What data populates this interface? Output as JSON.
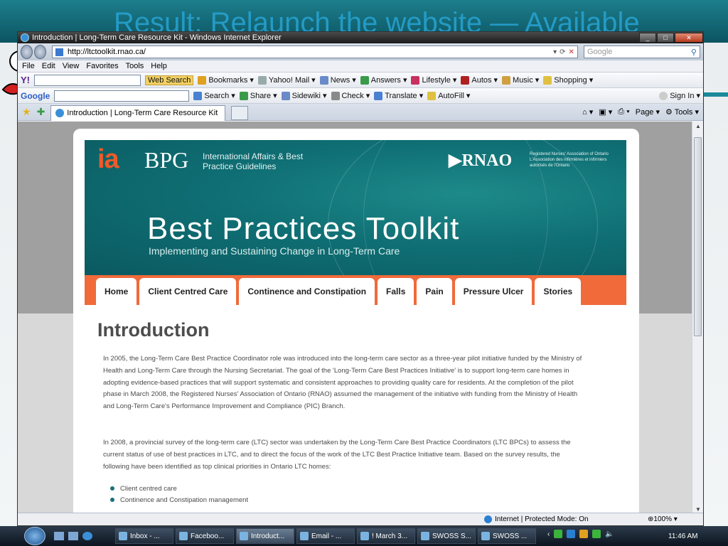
{
  "slide": {
    "title": "Result: Relaunch the website — Available"
  },
  "window": {
    "title": "Introduction | Long-Term Care Resource Kit - Windows Internet Explorer"
  },
  "address": {
    "url": "http://ltctoolkit.rnao.ca/",
    "search_placeholder": "Google"
  },
  "menu": [
    "File",
    "Edit",
    "View",
    "Favorites",
    "Tools",
    "Help"
  ],
  "yahoo_toolbar": {
    "web_search": "Web Search",
    "items": [
      "Bookmarks",
      "Yahoo! Mail",
      "News",
      "Answers",
      "Lifestyle",
      "Autos",
      "Music",
      "Shopping"
    ]
  },
  "google_toolbar": {
    "logo": "Google",
    "items": [
      "Search",
      "Share",
      "Sidewiki",
      "Check",
      "Translate",
      "AutoFill",
      "Sign In"
    ]
  },
  "tabbar": {
    "tab_label": "Introduction | Long-Term Care Resource Kit",
    "commands": [
      "Page",
      "Tools"
    ]
  },
  "page": {
    "ia": "ia",
    "bpg": "BPG",
    "bpg_sub": "International Affairs & Best Practice Guidelines",
    "rnao": "RNAO",
    "rnao_sub": "Registered Nurses' Association of Ontario L'Association des infirmières et infirmiers autorisés de l'Ontario",
    "title": "Best Practices Toolkit",
    "subtitle": "Implementing and Sustaining Change in Long-Term Care",
    "nav": [
      "Home",
      "Client Centred Care",
      "Continence and Constipation",
      "Falls",
      "Pain",
      "Pressure Ulcer",
      "Stories"
    ],
    "heading": "Introduction",
    "para1": "In 2005, the Long-Term Care Best Practice Coordinator role was introduced into the long-term care sector as a three-year pilot initiative funded by the Ministry of Health and Long-Term Care through the Nursing Secretariat. The goal of the 'Long-Term Care Best Practices Initiative' is to support long-term care homes in adopting evidence-based practices that will support systematic and consistent approaches to providing quality care for residents. At the completion of the pilot phase in March 2008, the Registered Nurses' Association of Ontario (RNAO) assumed the management of the initiative with funding from the Ministry of Health and Long-Term Care's Performance Improvement and Compliance (PIC) Branch.",
    "para2": "In 2008, a provincial survey of the long-term care (LTC) sector was undertaken by the Long-Term Care Best Practice Coordinators (LTC BPCs) to assess the current status of use of best practices in LTC, and to direct the focus of the work of the LTC Best Practice Initiative team. Based on the survey results, the following have been identified as top clinical priorities in Ontario LTC homes:",
    "bullets": [
      "Client centred care",
      "Continence and Constipation management"
    ]
  },
  "status": {
    "zone": "Internet | Protected Mode: On",
    "zoom": "100%"
  },
  "taskbar": {
    "tasks": [
      "Inbox - ...",
      "Faceboo...",
      "Introduct...",
      "Email - ...",
      "! March 3...",
      "SWOSS S...",
      "SWOSS ..."
    ],
    "clock": "11:46 AM"
  },
  "colors": {
    "banner": "#0f6f74",
    "nav_strip": "#f06a3a",
    "ia_orange": "#f05a28"
  }
}
